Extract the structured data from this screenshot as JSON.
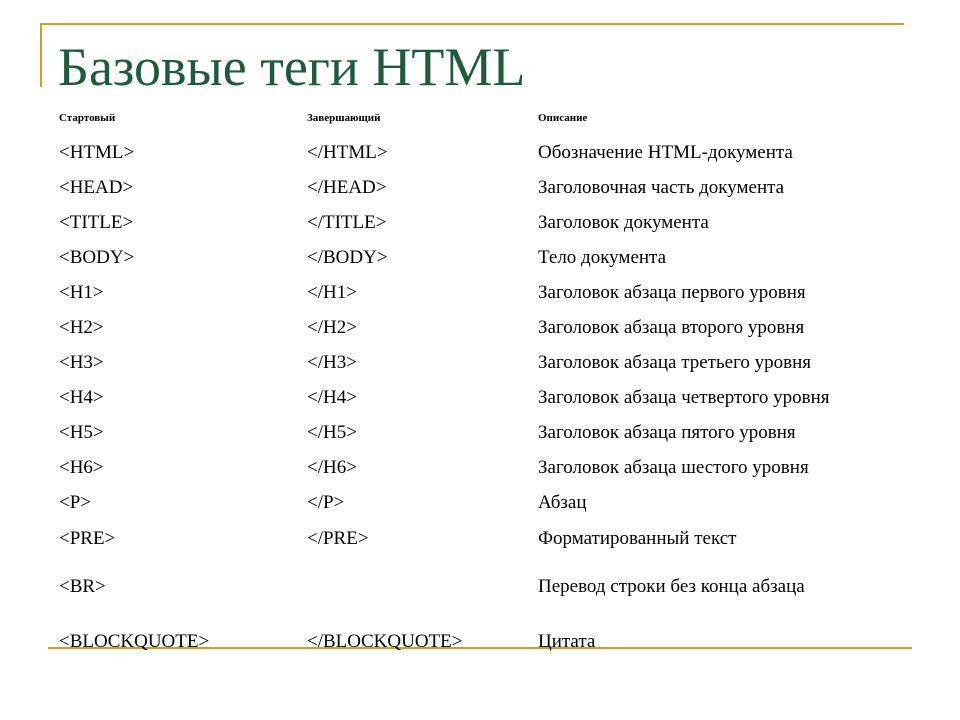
{
  "slide": {
    "title": "Базовые теги HTML",
    "accent_color": "#c9a227",
    "title_color": "#1f5a3a"
  },
  "table": {
    "headers": [
      "Стартовый",
      "Завершающий",
      "Описание"
    ],
    "rows": [
      {
        "start": "<HTML>",
        "end": "</HTML>",
        "desc": "Обозначение HTML-документа"
      },
      {
        "start": "<HEAD>",
        "end": "</HEAD>",
        "desc": "Заголовочная часть документа"
      },
      {
        "start": "<TITLE>",
        "end": "</TITLE>",
        "desc": "Заголовок документа"
      },
      {
        "start": "<BODY>",
        "end": "</BODY>",
        "desc": "Тело документа"
      },
      {
        "start": "<H1>",
        "end": "</H1>",
        "desc": "Заголовок абзаца первого уровня"
      },
      {
        "start": "<H2>",
        "end": "</H2>",
        "desc": "Заголовок абзаца второго уровня"
      },
      {
        "start": "<H3>",
        "end": "</H3>",
        "desc": "Заголовок абзаца третьего уровня"
      },
      {
        "start": "<H4>",
        "end": "</H4>",
        "desc": "Заголовок абзаца четвертого уровня"
      },
      {
        "start": "<H5>",
        "end": "</H5>",
        "desc": "Заголовок абзаца пятого уровня"
      },
      {
        "start": "<H6>",
        "end": "</H6>",
        "desc": "Заголовок абзаца шестого уровня"
      },
      {
        "start": "<P>",
        "end": "</P>",
        "desc": "Абзац"
      },
      {
        "start": "<PRE>",
        "end": "</PRE>",
        "desc": "Форматированный текст"
      },
      {
        "start": "<BR>",
        "end": "",
        "desc": "Перевод строки без конца абзаца"
      },
      {
        "start": "<BLOCKQUOTE>",
        "end": "</BLOCKQUOTE>",
        "desc": "Цитата"
      }
    ]
  }
}
